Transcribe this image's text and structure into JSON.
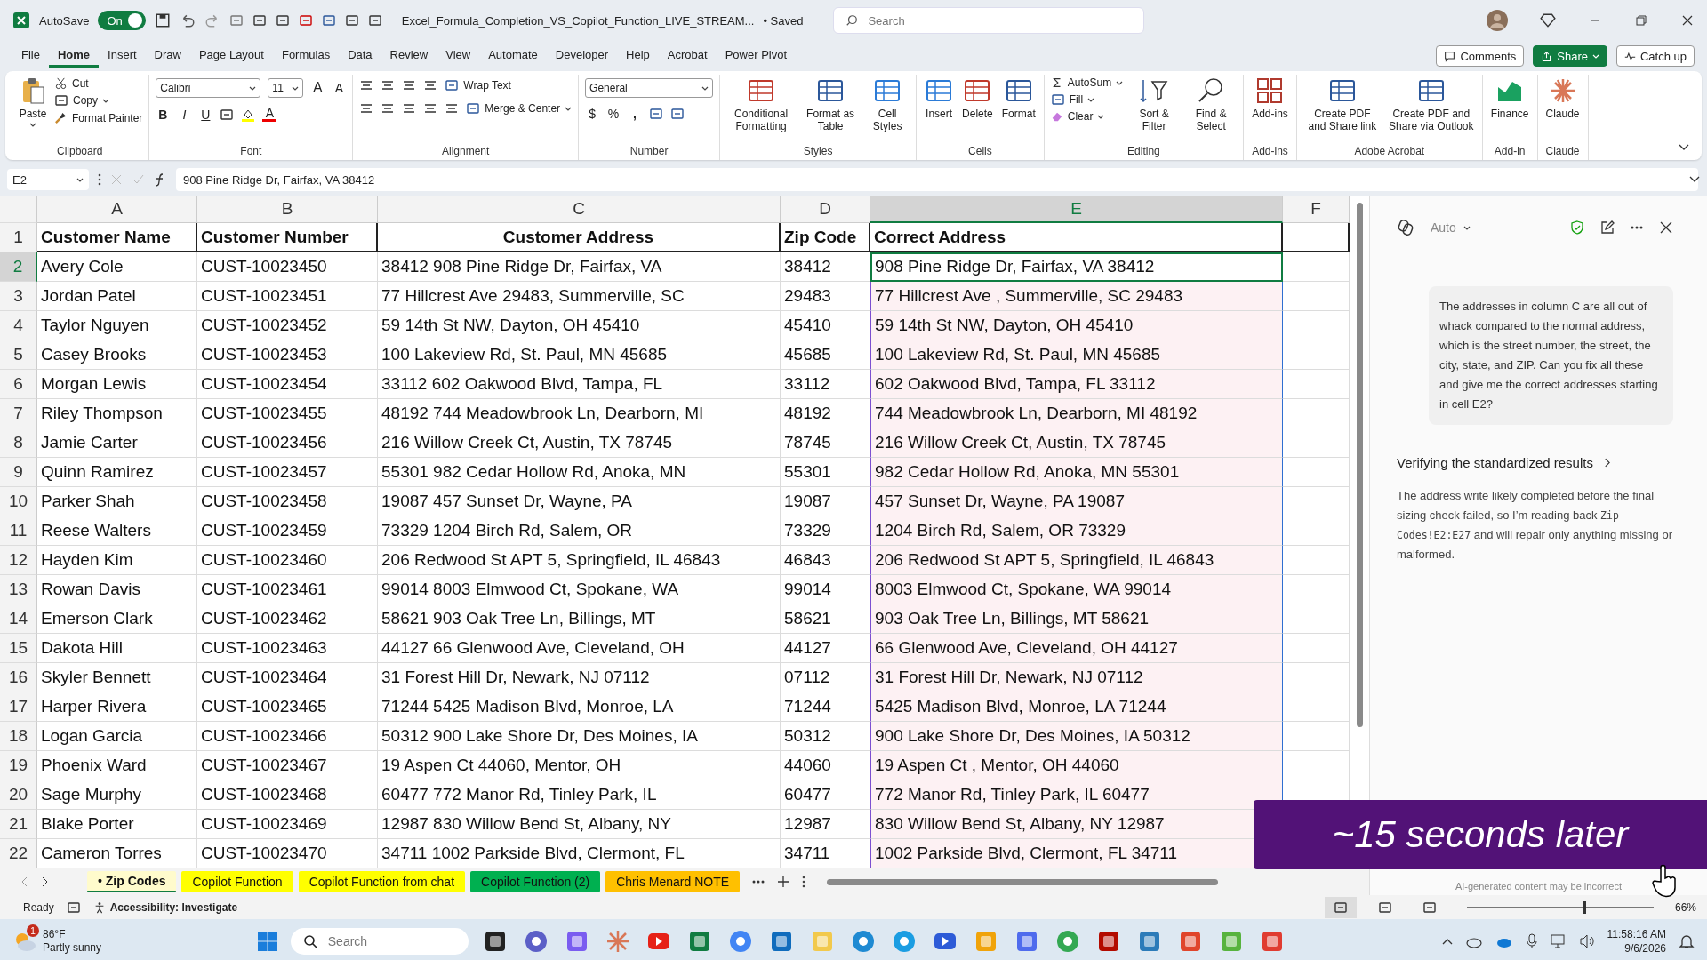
{
  "title_bar": {
    "autosave_label": "AutoSave",
    "autosave_on": true,
    "autosave_state": "On",
    "filename": "Excel_Formula_Completion_VS_Copilot_Function_LIVE_STREAM...",
    "saved_status": "• Saved",
    "search_placeholder": "Search"
  },
  "menu_tabs": [
    {
      "label": "File",
      "selected": false
    },
    {
      "label": "Home",
      "selected": true
    },
    {
      "label": "Insert",
      "selected": false
    },
    {
      "label": "Draw",
      "selected": false
    },
    {
      "label": "Page Layout",
      "selected": false
    },
    {
      "label": "Formulas",
      "selected": false
    },
    {
      "label": "Data",
      "selected": false
    },
    {
      "label": "Review",
      "selected": false
    },
    {
      "label": "View",
      "selected": false
    },
    {
      "label": "Automate",
      "selected": false
    },
    {
      "label": "Developer",
      "selected": false
    },
    {
      "label": "Help",
      "selected": false
    },
    {
      "label": "Acrobat",
      "selected": false
    },
    {
      "label": "Power Pivot",
      "selected": false
    }
  ],
  "header_buttons": {
    "comments": "Comments",
    "share": "Share",
    "catch_up": "Catch up"
  },
  "ribbon": {
    "clipboard": {
      "label": "Clipboard",
      "paste": "Paste",
      "cut": "Cut",
      "copy": "Copy",
      "format_painter": "Format Painter"
    },
    "font": {
      "label": "Font",
      "font_name": "Calibri",
      "font_size": "11",
      "grow": "A",
      "shrink": "A",
      "bold": "B",
      "italic": "I",
      "underline": "U",
      "color_glyph": "A"
    },
    "alignment": {
      "label": "Alignment",
      "wrap_text": "Wrap Text",
      "merge_center": "Merge & Center"
    },
    "number": {
      "label": "Number",
      "format": "General",
      "currency": "$",
      "percent": "%",
      "comma": ","
    },
    "styles": {
      "label": "Styles",
      "conditional": "Conditional Formatting",
      "format_table": "Format as Table",
      "cell_styles": "Cell Styles"
    },
    "cells": {
      "label": "Cells",
      "insert": "Insert",
      "delete": "Delete",
      "format": "Format"
    },
    "editing": {
      "label": "Editing",
      "autosum": "AutoSum",
      "fill": "Fill",
      "clear": "Clear",
      "sort_filter": "Sort & Filter",
      "find_select": "Find & Select"
    },
    "addins": {
      "label": "Add-ins",
      "addins": "Add-ins"
    },
    "acrobat": {
      "label": "Adobe Acrobat",
      "share_link": "Create PDF and Share link",
      "share_outlook": "Create PDF and Share via Outlook"
    },
    "addin": {
      "label": "Add-in",
      "finance": "Finance"
    },
    "claude": {
      "label": "Claude",
      "claude": "Claude"
    }
  },
  "formula_bar": {
    "name_box": "E2",
    "formula": "908 Pine Ridge Dr, Fairfax, VA 38412"
  },
  "sheet": {
    "columns": [
      {
        "label": "A",
        "selected": false,
        "highlighted": false
      },
      {
        "label": "B",
        "selected": false,
        "highlighted": false
      },
      {
        "label": "C",
        "selected": false,
        "highlighted": false
      },
      {
        "label": "D",
        "selected": false,
        "highlighted": false
      },
      {
        "label": "E",
        "selected": true,
        "highlighted": true
      },
      {
        "label": "F",
        "selected": false,
        "highlighted": false
      }
    ],
    "header_row": {
      "number": "1",
      "cells": [
        "Customer Name",
        "Customer Number",
        "Customer Address",
        "Zip Code",
        "Correct Address"
      ]
    },
    "rows": [
      {
        "number": "2",
        "selected": true,
        "cells": [
          "Avery Cole",
          "CUST-10023450",
          "38412 908 Pine Ridge Dr, Fairfax, VA",
          "38412",
          "908 Pine Ridge Dr, Fairfax, VA 38412"
        ]
      },
      {
        "number": "3",
        "selected": false,
        "cells": [
          "Jordan Patel",
          "CUST-10023451",
          "77 Hillcrest Ave 29483, Summerville, SC",
          "29483",
          "77 Hillcrest Ave , Summerville, SC 29483"
        ]
      },
      {
        "number": "4",
        "selected": false,
        "cells": [
          "Taylor Nguyen",
          "CUST-10023452",
          "59 14th St NW, Dayton, OH 45410",
          "45410",
          "59 14th St NW, Dayton, OH 45410"
        ]
      },
      {
        "number": "5",
        "selected": false,
        "cells": [
          "Casey Brooks",
          "CUST-10023453",
          "100 Lakeview Rd, St. Paul, MN 45685",
          "45685",
          "100 Lakeview Rd, St. Paul, MN 45685"
        ]
      },
      {
        "number": "6",
        "selected": false,
        "cells": [
          "Morgan Lewis",
          "CUST-10023454",
          "33112 602 Oakwood Blvd, Tampa, FL",
          "33112",
          "602 Oakwood Blvd, Tampa, FL 33112"
        ]
      },
      {
        "number": "7",
        "selected": false,
        "cells": [
          "Riley Thompson",
          "CUST-10023455",
          "48192 744 Meadowbrook Ln, Dearborn, MI",
          "48192",
          "744 Meadowbrook Ln, Dearborn, MI 48192"
        ]
      },
      {
        "number": "8",
        "selected": false,
        "cells": [
          "Jamie Carter",
          "CUST-10023456",
          "216 Willow Creek Ct, Austin, TX 78745",
          "78745",
          "216 Willow Creek Ct, Austin, TX 78745"
        ]
      },
      {
        "number": "9",
        "selected": false,
        "cells": [
          "Quinn Ramirez",
          "CUST-10023457",
          "55301 982 Cedar Hollow Rd, Anoka, MN",
          "55301",
          "982 Cedar Hollow Rd, Anoka, MN 55301"
        ]
      },
      {
        "number": "10",
        "selected": false,
        "cells": [
          "Parker Shah",
          "CUST-10023458",
          "19087 457 Sunset Dr, Wayne, PA",
          "19087",
          "457 Sunset Dr, Wayne, PA 19087"
        ]
      },
      {
        "number": "11",
        "selected": false,
        "cells": [
          "Reese Walters",
          "CUST-10023459",
          "73329 1204 Birch Rd, Salem, OR",
          "73329",
          "1204 Birch Rd, Salem, OR 73329"
        ]
      },
      {
        "number": "12",
        "selected": false,
        "cells": [
          "Hayden Kim",
          "CUST-10023460",
          "206 Redwood St APT 5, Springfield, IL 46843",
          "46843",
          "206 Redwood St APT 5, Springfield, IL 46843"
        ]
      },
      {
        "number": "13",
        "selected": false,
        "cells": [
          "Rowan Davis",
          "CUST-10023461",
          "99014 8003 Elmwood Ct, Spokane, WA",
          "99014",
          "8003 Elmwood Ct, Spokane, WA 99014"
        ]
      },
      {
        "number": "14",
        "selected": false,
        "cells": [
          "Emerson Clark",
          "CUST-10023462",
          "58621 903 Oak Tree Ln, Billings, MT",
          "58621",
          "903 Oak Tree Ln, Billings, MT 58621"
        ]
      },
      {
        "number": "15",
        "selected": false,
        "cells": [
          "Dakota Hill",
          "CUST-10023463",
          "44127 66 Glenwood Ave, Cleveland, OH",
          "44127",
          "66 Glenwood Ave, Cleveland, OH 44127"
        ]
      },
      {
        "number": "16",
        "selected": false,
        "cells": [
          "Skyler Bennett",
          "CUST-10023464",
          "31 Forest Hill Dr, Newark, NJ 07112",
          "07112",
          "31 Forest Hill Dr, Newark, NJ 07112"
        ]
      },
      {
        "number": "17",
        "selected": false,
        "cells": [
          "Harper Rivera",
          "CUST-10023465",
          "71244 5425 Madison Blvd, Monroe, LA",
          "71244",
          "5425 Madison Blvd, Monroe, LA 71244"
        ]
      },
      {
        "number": "18",
        "selected": false,
        "cells": [
          "Logan Garcia",
          "CUST-10023466",
          "50312 900 Lake Shore Dr, Des Moines, IA",
          "50312",
          "900 Lake Shore Dr, Des Moines, IA 50312"
        ]
      },
      {
        "number": "19",
        "selected": false,
        "cells": [
          "Phoenix Ward",
          "CUST-10023467",
          "19 Aspen Ct 44060, Mentor, OH",
          "44060",
          "19 Aspen Ct , Mentor, OH 44060"
        ]
      },
      {
        "number": "20",
        "selected": false,
        "cells": [
          "Sage Murphy",
          "CUST-10023468",
          "60477 772 Manor Rd, Tinley Park, IL",
          "60477",
          "772 Manor Rd, Tinley Park, IL 60477"
        ]
      },
      {
        "number": "21",
        "selected": false,
        "cells": [
          "Blake Porter",
          "CUST-10023469",
          "12987 830 Willow Bend St, Albany, NY",
          "12987",
          "830 Willow Bend St, Albany, NY 12987"
        ]
      },
      {
        "number": "22",
        "selected": false,
        "cells": [
          "Cameron Torres",
          "CUST-10023470",
          "34711 1002 Parkside Blvd, Clermont, FL",
          "34711",
          "1002 Parkside Blvd, Clermont, FL 34711"
        ]
      }
    ]
  },
  "copilot_panel": {
    "mode": "Auto",
    "prompt": "The addresses in column C are all out of whack compared to the normal address, which is the street number, the street, the city, state, and ZIP. Can you fix all these and give me the correct addresses starting in cell E2?",
    "step_title": "Verifying the standardized results",
    "response_before": "The address write likely completed before the final sizing check failed, so I’m reading back ",
    "response_code": "Zip Codes!E2:E27",
    "response_after": " and will repair only anything missing or malformed.",
    "disclaimer": "AI-generated content may be incorrect"
  },
  "overlay": "~15 seconds later",
  "sheet_tabs": [
    {
      "label": "• Zip Codes",
      "selected": true,
      "color": "#fffbcc"
    },
    {
      "label": "Copilot Function",
      "selected": false,
      "color": "#ffff00"
    },
    {
      "label": "Copilot Function from chat",
      "selected": false,
      "color": "#ffff00"
    },
    {
      "label": "Copilot Function (2)",
      "selected": false,
      "color": "#00b050"
    },
    {
      "label": "Chris Menard NOTE",
      "selected": false,
      "color": "#ffc000"
    }
  ],
  "status_bar": {
    "ready": "Ready",
    "accessibility": "Accessibility: Investigate",
    "zoom": "66%",
    "zoom_slider": {
      "level": 0.62
    }
  },
  "taskbar": {
    "weather_badge": "1",
    "temperature": "86°F",
    "weather": "Partly sunny",
    "search_placeholder": "Search",
    "time": "11:58:16 AM",
    "date": "9/6/2026"
  }
}
